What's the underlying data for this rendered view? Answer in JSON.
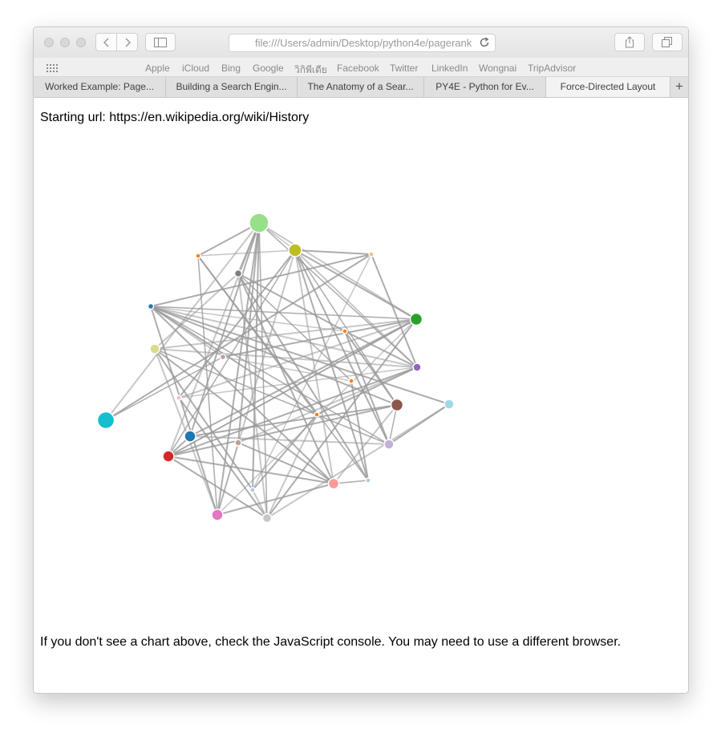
{
  "browser": {
    "address": "file:///Users/admin/Desktop/python4e/pagerank",
    "favorites": [
      "Apple",
      "iCloud",
      "Bing",
      "Google",
      "วิกิพีเดีย",
      "Facebook",
      "Twitter",
      "LinkedIn",
      "Wongnai",
      "TripAdvisor"
    ],
    "tabs": [
      {
        "label": "Worked Example: Page..."
      },
      {
        "label": "Building a Search Engin..."
      },
      {
        "label": "The Anatomy of a Sear..."
      },
      {
        "label": "PY4E - Python for Ev..."
      },
      {
        "label": "Force-Directed Layout"
      }
    ],
    "new_tab_label": "+"
  },
  "page": {
    "starting_url_text": "Starting url: https://en.wikipedia.org/wiki/History",
    "footer_text": "If you don't see a chart above, check the JavaScript console. You may need to use a different browser."
  },
  "graph": {
    "link_color": "#999999",
    "nodes": [
      {
        "id": 0,
        "color": "#98df8a",
        "size": 12
      },
      {
        "id": 1,
        "color": "#bcbd22",
        "size": 8
      },
      {
        "id": 2,
        "color": "#ff7f0e",
        "size": 3
      },
      {
        "id": 3,
        "color": "#ffbb78",
        "size": 3
      },
      {
        "id": 4,
        "color": "#7f7f7f",
        "size": 4.5
      },
      {
        "id": 5,
        "color": "#1f77b4",
        "size": 3.5
      },
      {
        "id": 6,
        "color": "#2ca02c",
        "size": 7.5
      },
      {
        "id": 7,
        "color": "#ff7f0e",
        "size": 3
      },
      {
        "id": 8,
        "color": "#dbdb8d",
        "size": 6
      },
      {
        "id": 9,
        "color": "#c49c94",
        "size": 3.5
      },
      {
        "id": 10,
        "color": "#9467bd",
        "size": 5
      },
      {
        "id": 11,
        "color": "#ff7f0e",
        "size": 3
      },
      {
        "id": 12,
        "color": "#8c564b",
        "size": 7.5
      },
      {
        "id": 13,
        "color": "#9edae5",
        "size": 6
      },
      {
        "id": 14,
        "color": "#f7b6d2",
        "size": 3
      },
      {
        "id": 15,
        "color": "#ff7f0e",
        "size": 3
      },
      {
        "id": 16,
        "color": "#17becf",
        "size": 10.5
      },
      {
        "id": 17,
        "color": "#1f77b4",
        "size": 7
      },
      {
        "id": 18,
        "color": "#c49c94",
        "size": 4
      },
      {
        "id": 19,
        "color": "#c5b0d5",
        "size": 6
      },
      {
        "id": 20,
        "color": "#d62728",
        "size": 7
      },
      {
        "id": 21,
        "color": "#ff9896",
        "size": 6.5
      },
      {
        "id": 22,
        "color": "#aec7e8",
        "size": 3
      },
      {
        "id": 23,
        "color": "#aec7e8",
        "size": 3
      },
      {
        "id": 24,
        "color": "#e377c2",
        "size": 7
      },
      {
        "id": 25,
        "color": "#c7c7c7",
        "size": 5.5
      }
    ],
    "links": [
      [
        0,
        1
      ],
      [
        0,
        4
      ],
      [
        0,
        2
      ],
      [
        0,
        6
      ],
      [
        0,
        10
      ],
      [
        0,
        17
      ],
      [
        0,
        20
      ],
      [
        0,
        24
      ],
      [
        0,
        25
      ],
      [
        0,
        16
      ],
      [
        0,
        22
      ],
      [
        0,
        18
      ],
      [
        1,
        2
      ],
      [
        1,
        3
      ],
      [
        1,
        6
      ],
      [
        1,
        10
      ],
      [
        1,
        12
      ],
      [
        1,
        19
      ],
      [
        1,
        24
      ],
      [
        1,
        14
      ],
      [
        1,
        20
      ],
      [
        1,
        21
      ],
      [
        1,
        23
      ],
      [
        3,
        5
      ],
      [
        3,
        22
      ],
      [
        3,
        10
      ],
      [
        4,
        7
      ],
      [
        4,
        8
      ],
      [
        4,
        11
      ],
      [
        4,
        21
      ],
      [
        4,
        25
      ],
      [
        4,
        23
      ],
      [
        5,
        6
      ],
      [
        5,
        10
      ],
      [
        5,
        12
      ],
      [
        5,
        21
      ],
      [
        5,
        7
      ],
      [
        5,
        15
      ],
      [
        5,
        24
      ],
      [
        5,
        9
      ],
      [
        5,
        19
      ],
      [
        5,
        13
      ],
      [
        6,
        8
      ],
      [
        6,
        17
      ],
      [
        6,
        20
      ],
      [
        6,
        14
      ],
      [
        6,
        9
      ],
      [
        6,
        25
      ],
      [
        6,
        24
      ],
      [
        7,
        10
      ],
      [
        7,
        12
      ],
      [
        8,
        10
      ],
      [
        8,
        19
      ],
      [
        8,
        22
      ],
      [
        8,
        24
      ],
      [
        8,
        21
      ],
      [
        2,
        23
      ],
      [
        10,
        18
      ],
      [
        10,
        15
      ],
      [
        10,
        20
      ],
      [
        10,
        14
      ],
      [
        12,
        20
      ],
      [
        12,
        17
      ],
      [
        12,
        21
      ],
      [
        12,
        19
      ],
      [
        13,
        19
      ],
      [
        13,
        25
      ],
      [
        16,
        3
      ],
      [
        16,
        9
      ],
      [
        17,
        19
      ],
      [
        17,
        20
      ],
      [
        18,
        21
      ],
      [
        18,
        24
      ],
      [
        20,
        21
      ],
      [
        20,
        25
      ],
      [
        20,
        6
      ],
      [
        21,
        23
      ],
      [
        21,
        24
      ],
      [
        22,
        25
      ],
      [
        22,
        15
      ],
      [
        24,
        2
      ],
      [
        25,
        15
      ],
      [
        23,
        11
      ],
      [
        14,
        25
      ],
      [
        9,
        11
      ],
      [
        2,
        15
      ],
      [
        19,
        7
      ]
    ]
  }
}
